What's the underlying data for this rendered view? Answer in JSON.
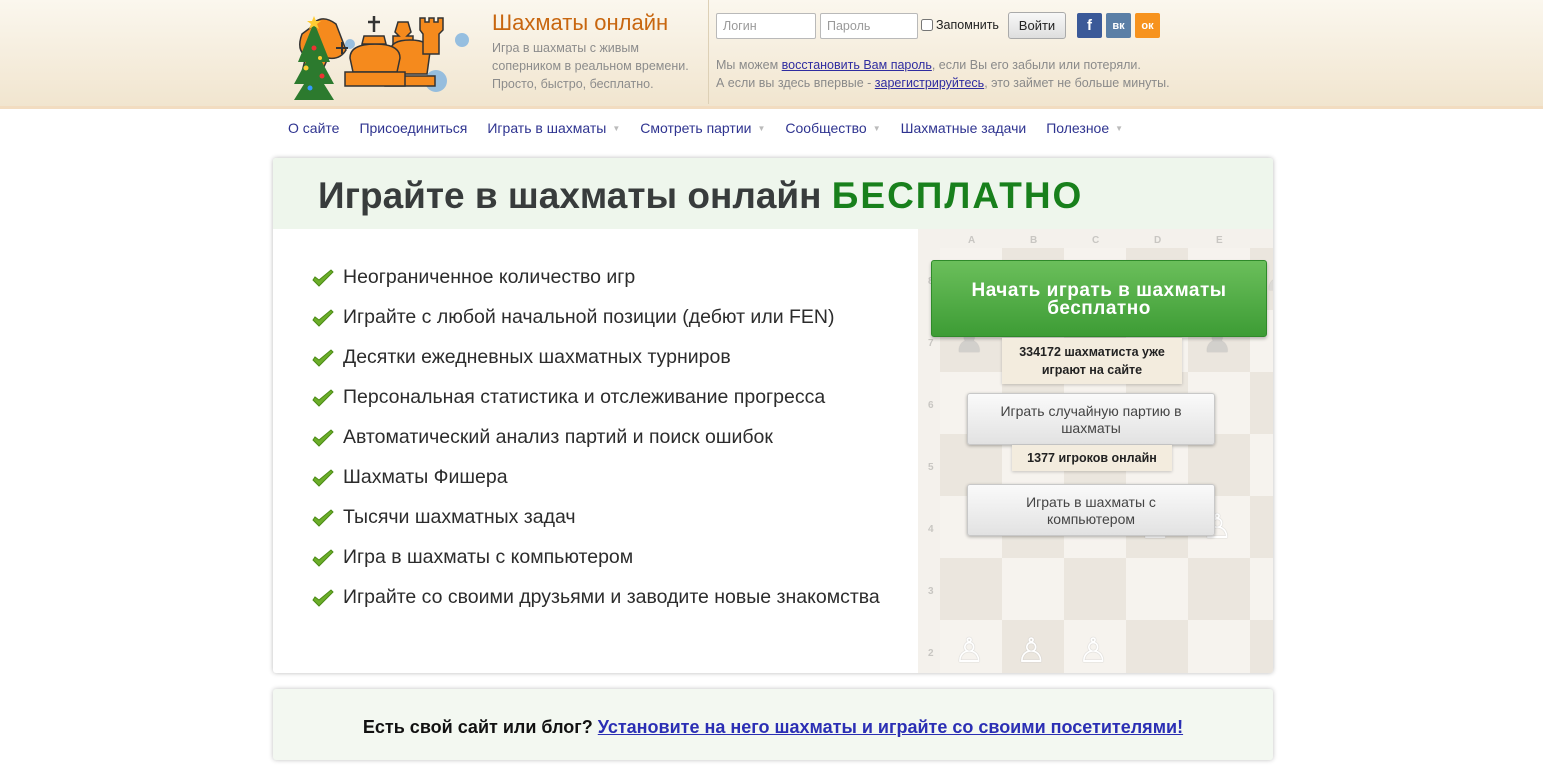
{
  "header": {
    "site_title": "Шахматы онлайн",
    "tagline": "Игра в шахматы с живым соперником в реальном времени. Просто, быстро, бесплатно.",
    "login_placeholder": "Логин",
    "password_placeholder": "Пароль",
    "remember_label": "Запомнить",
    "login_button": "Войти",
    "social": [
      {
        "icon": "facebook-icon",
        "glyph": "f",
        "color": "#3b5998"
      },
      {
        "icon": "vk-icon",
        "glyph": "вк",
        "color": "#5b7fa6"
      },
      {
        "icon": "odnoklassniki-icon",
        "glyph": "ок",
        "color": "#f7931e"
      }
    ],
    "hint1_pre": "Мы можем ",
    "hint1_link": "восстановить Вам пароль",
    "hint1_post": ", если Вы его забыли или потеряли.",
    "hint2_pre": "А если вы здесь впервые - ",
    "hint2_link": "зарегистрируйтесь",
    "hint2_post": ", это займет не больше минуты."
  },
  "nav": [
    {
      "label": "О сайте",
      "dropdown": false
    },
    {
      "label": "Присоединиться",
      "dropdown": false
    },
    {
      "label": "Играть в шахматы",
      "dropdown": true
    },
    {
      "label": "Смотреть партии",
      "dropdown": true
    },
    {
      "label": "Сообщество",
      "dropdown": true
    },
    {
      "label": "Шахматные задачи",
      "dropdown": false
    },
    {
      "label": "Полезное",
      "dropdown": true
    }
  ],
  "main": {
    "title": "Играйте в шахматы онлайн",
    "title_accent": "БЕСПЛАТНО",
    "features": [
      "Неограниченное количество игр",
      "Играйте с любой начальной позиции (дебют или FEN)",
      "Десятки ежедневных шахматных турниров",
      "Персональная статистика и отслеживание прогресса",
      "Автоматический анализ партий и поиск ошибок",
      "Шахматы Фишера",
      "Тысячи шахматных задач",
      "Игра в шахматы с компьютером",
      "Играйте со своими друзьями и заводите новые знакомства"
    ],
    "start_button_line1": "Начать играть в шахматы",
    "start_button_line2": "бесплатно",
    "players_count_line1": "334172 шахматиста уже",
    "players_count_line2": "играют на сайте",
    "random_game_line1": "Играть случайную партию в",
    "random_game_line2": "шахматы",
    "online_count": "1377 игроков онлайн",
    "computer_game_line1": "Играть в шахматы с",
    "computer_game_line2": "компьютером"
  },
  "board": {
    "files": [
      "A",
      "B",
      "C",
      "D",
      "E"
    ],
    "ranks": [
      "8",
      "7",
      "6",
      "5",
      "4",
      "3",
      "2"
    ]
  },
  "footer_banner": {
    "text": "Есть свой сайт или блог?",
    "link": "Установите на него шахматы и играйте со своими посетителями!"
  }
}
